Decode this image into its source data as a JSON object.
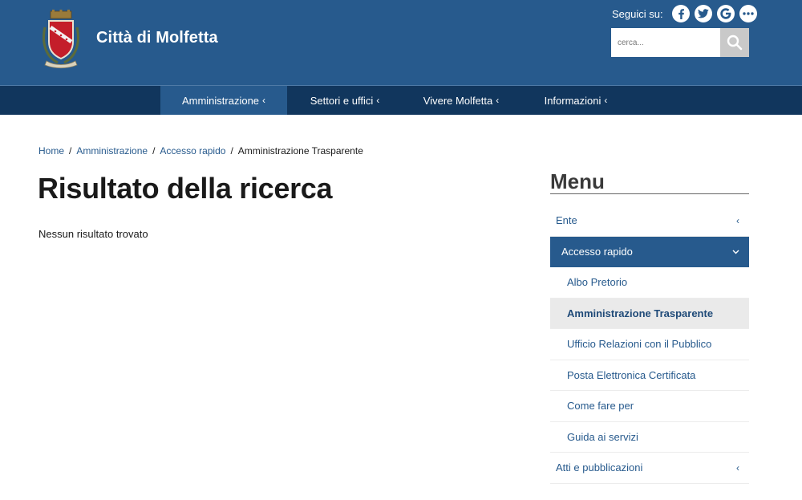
{
  "header": {
    "site_title": "Città di Molfetta",
    "social_label": "Seguici su:",
    "social_icons": [
      "facebook-icon",
      "twitter-icon",
      "google-icon",
      "more-icon"
    ],
    "search_placeholder": "cerca...",
    "colors": {
      "header_bg": "#275a8d",
      "nav_bg": "#11365d",
      "accent": "#275a8d"
    }
  },
  "nav": {
    "items": [
      {
        "label": "Amministrazione",
        "active": true
      },
      {
        "label": "Settori e uffici",
        "active": false
      },
      {
        "label": "Vivere Molfetta",
        "active": false
      },
      {
        "label": "Informazioni",
        "active": false
      }
    ]
  },
  "breadcrumb": {
    "items": [
      "Home",
      "Amministrazione",
      "Accesso rapido"
    ],
    "current": "Amministrazione Trasparente"
  },
  "main": {
    "title": "Risultato della ricerca",
    "message": "Nessun risultato trovato"
  },
  "sidebar": {
    "title": "Menu",
    "items": [
      {
        "label": "Ente"
      },
      {
        "label": "Accesso rapido"
      },
      {
        "label": "Albo Pretorio"
      },
      {
        "label": "Amministrazione Trasparente"
      },
      {
        "label": "Ufficio Relazioni con il Pubblico"
      },
      {
        "label": "Posta Elettronica Certificata"
      },
      {
        "label": "Come fare per"
      },
      {
        "label": "Guida ai servizi"
      },
      {
        "label": "Atti e pubblicazioni"
      }
    ]
  }
}
